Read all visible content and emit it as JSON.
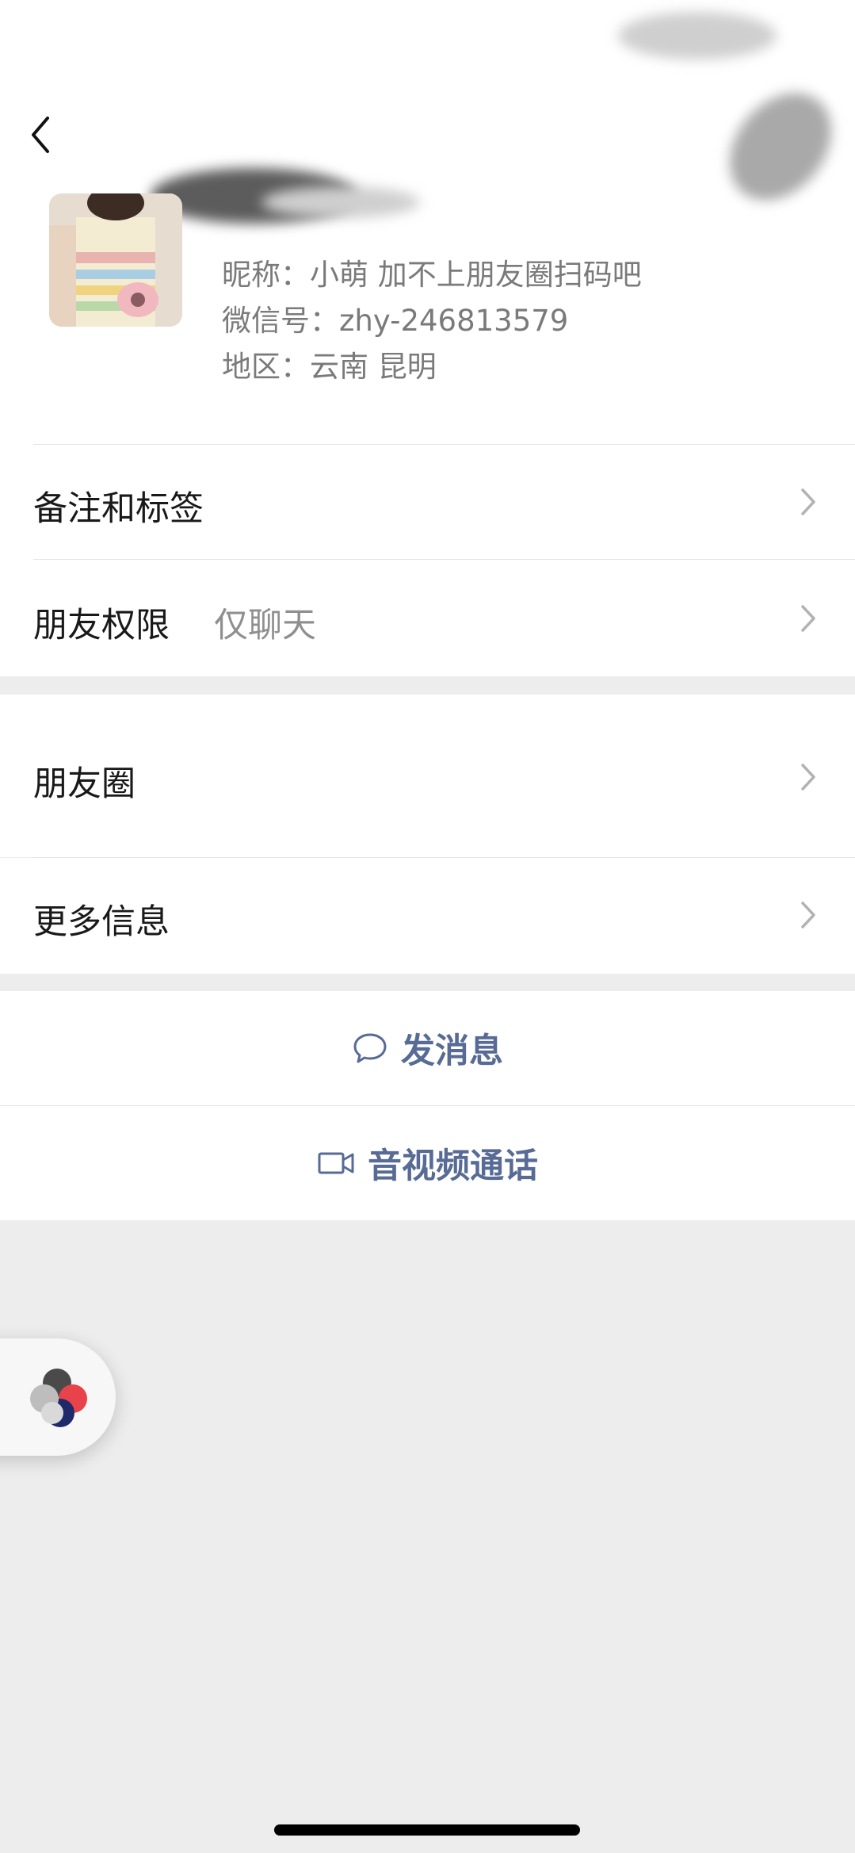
{
  "profile": {
    "nickname_line": "昵称：小萌  加不上朋友圈扫码吧",
    "wechat_id_line": "微信号：zhy-246813579",
    "region_line": "地区：云南 昆明"
  },
  "settings": {
    "remark_label": "备注和标签",
    "permission_label": "朋友权限",
    "permission_value": "仅聊天"
  },
  "sections": {
    "moments_label": "朋友圈",
    "more_info_label": "更多信息"
  },
  "actions": {
    "message_label": "发消息",
    "call_label": "音视频通话"
  },
  "icons": {
    "back": "chevron-left-icon",
    "row_arrow": "chevron-right-icon",
    "message": "chat-bubble-icon",
    "call": "video-camera-icon",
    "floating": "floating-window-icon"
  },
  "colors": {
    "link_blue": "#576b95",
    "background": "#ededed"
  }
}
